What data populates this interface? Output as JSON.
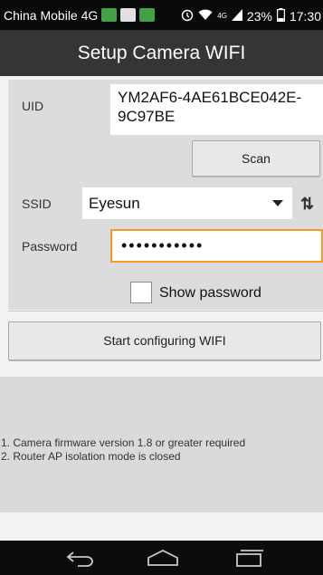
{
  "status_bar": {
    "carrier": "China Mobile 4G",
    "signal_label": "4G",
    "battery": "23%",
    "time": "17:30"
  },
  "header": {
    "title": "Setup Camera WIFI"
  },
  "form": {
    "uid_label": "UID",
    "uid_value": "YM2AF6-4AE61BCE042E-9C97BE",
    "scan_label": "Scan",
    "ssid_label": "SSID",
    "ssid_value": "Eyesun",
    "password_label": "Password",
    "password_value": "•••••••••••",
    "show_password_label": "Show password",
    "show_password_checked": false
  },
  "start_button_label": "Start configuring WIFI",
  "notes": [
    "1. Camera firmware version 1.8 or greater required",
    "2. Router AP isolation mode is closed"
  ],
  "colors": {
    "action_bar": "#353535",
    "status_bar": "#0a0a0a",
    "focus_border": "#f59a2a",
    "panel": "#dcdcdc"
  },
  "icons": {
    "back": "back-arrow-icon",
    "home": "home-icon",
    "recents": "recents-icon",
    "wifi_refresh": "wifi-refresh-icon"
  }
}
